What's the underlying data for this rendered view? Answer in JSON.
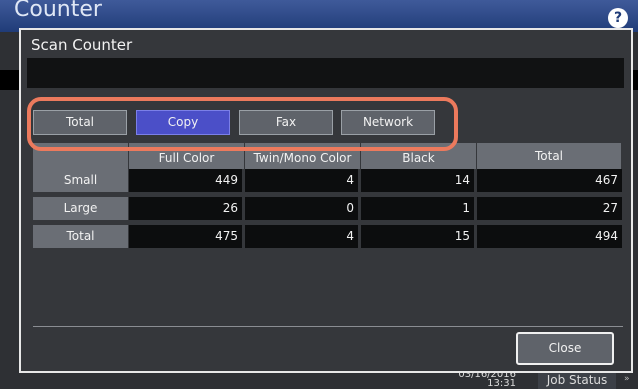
{
  "app": {
    "title": "Counter",
    "help_icon": "?"
  },
  "dialog": {
    "title": "Scan Counter"
  },
  "tabs": [
    {
      "label": "Total",
      "active": false
    },
    {
      "label": "Copy",
      "active": true
    },
    {
      "label": "Fax",
      "active": false
    },
    {
      "label": "Network",
      "active": false
    }
  ],
  "table": {
    "columns": [
      "Full Color",
      "Twin/Mono Color",
      "Black",
      "Total"
    ],
    "rows": [
      {
        "label": "Small",
        "values": [
          "449",
          "4",
          "14",
          "467"
        ]
      },
      {
        "label": "Large",
        "values": [
          "26",
          "0",
          "1",
          "27"
        ]
      },
      {
        "label": "Total",
        "values": [
          "475",
          "4",
          "15",
          "494"
        ]
      }
    ]
  },
  "buttons": {
    "close": "Close"
  },
  "status": {
    "date": "03/16/2016",
    "time": "13:31",
    "job_status": "Job Status"
  },
  "colors": {
    "active_tab": "#4b4fc8",
    "highlight": "#ec7a5d",
    "header": "#203c78"
  }
}
